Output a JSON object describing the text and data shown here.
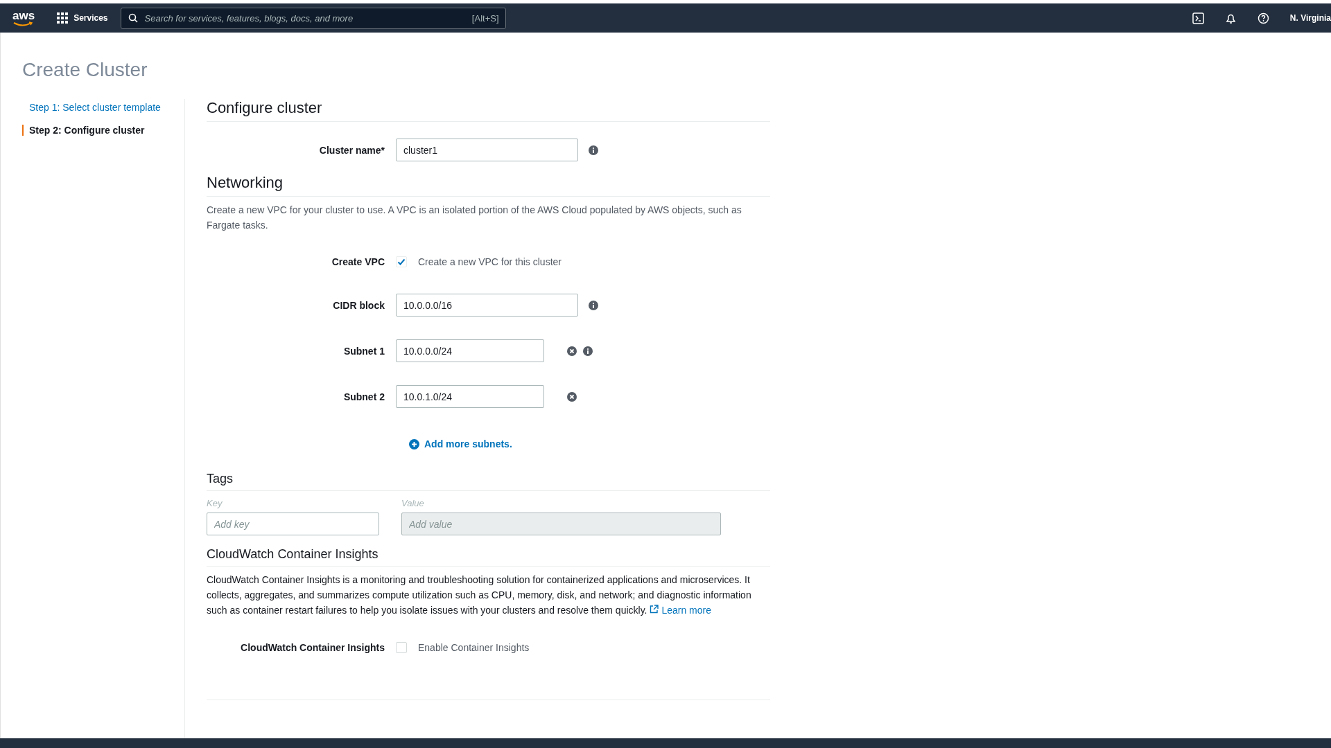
{
  "nav": {
    "logo": "aws",
    "services": "Services",
    "search_placeholder": "Search for services, features, blogs, docs, and more",
    "shortcut": "[Alt+S]",
    "region": "N. Virginia"
  },
  "title": "Create Cluster",
  "steps": [
    {
      "label": "Step 1: Select cluster template",
      "selected": false
    },
    {
      "label": "Step 2: Configure cluster",
      "selected": true
    }
  ],
  "configure": {
    "heading": "Configure cluster",
    "cluster_name": {
      "label": "Cluster name*",
      "value": "cluster1"
    }
  },
  "networking": {
    "heading": "Networking",
    "description": "Create a new VPC for your cluster to use. A VPC is an isolated portion of the AWS Cloud populated by AWS objects, such as Fargate tasks.",
    "create_vpc": {
      "label": "Create VPC",
      "checked": true,
      "text": "Create a new VPC for this cluster"
    },
    "cidr": {
      "label": "CIDR block",
      "value": "10.0.0.0/16"
    },
    "subnets": [
      {
        "label": "Subnet 1",
        "value": "10.0.0.0/24",
        "info": true
      },
      {
        "label": "Subnet 2",
        "value": "10.0.1.0/24",
        "info": false
      }
    ],
    "add_more": "Add more subnets."
  },
  "tags": {
    "heading": "Tags",
    "key_label": "Key",
    "value_label": "Value",
    "key_placeholder": "Add key",
    "value_placeholder": "Add value",
    "value_disabled": true
  },
  "insights": {
    "heading": "CloudWatch Container Insights",
    "description": "CloudWatch Container Insights is a monitoring and troubleshooting solution for containerized applications and microservices. It collects, aggregates, and summarizes compute utilization such as CPU, memory, disk, and network; and diagnostic information such as container restart failures to help you isolate issues with your clusters and resolve them quickly.",
    "link": "Learn more",
    "label": "CloudWatch Container Insights",
    "checked": false,
    "text": "Enable Container Insights"
  }
}
